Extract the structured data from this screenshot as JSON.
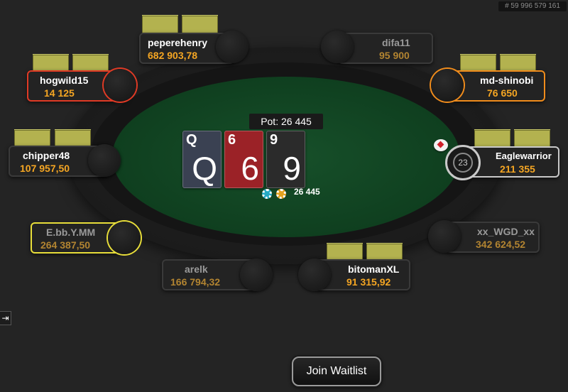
{
  "hand_id": "# 59 996 579 161",
  "pot": {
    "label": "Pot: 26 445"
  },
  "board": [
    {
      "rank": "Q",
      "suit": "spades",
      "color": "#3a4152"
    },
    {
      "rank": "6",
      "suit": "hearts",
      "color": "#9b2227"
    },
    {
      "rank": "9",
      "suit": "spades",
      "color": "#2b2b2b"
    }
  ],
  "bet": {
    "amount": "26 445"
  },
  "seats": [
    {
      "name": "peperehenry",
      "stack": "682 903,78",
      "status": "active"
    },
    {
      "name": "difa11",
      "stack": "95 900",
      "status": "folded"
    },
    {
      "name": "hogwild15",
      "stack": "14 125",
      "status": "highlighted",
      "highlight_color": "#e03a25"
    },
    {
      "name": "md-shinobi",
      "stack": "76 650",
      "status": "highlighted",
      "highlight_color": "#f08c1c"
    },
    {
      "name": "chipper48",
      "stack": "107 957,50",
      "status": "active"
    },
    {
      "name": "Eaglewarrior",
      "stack": "211 355",
      "status": "acting",
      "highlight_color": "#c9c9c9",
      "timer": "23"
    },
    {
      "name": "E.bb.Y.MM",
      "stack": "264 387,50",
      "status": "highlighted-folded",
      "highlight_color": "#e8de3a"
    },
    {
      "name": "xx_WGD_xx",
      "stack": "342 624,52",
      "status": "folded"
    },
    {
      "name": "arelk",
      "stack": "166 794,32",
      "status": "folded"
    },
    {
      "name": "bitomanXL",
      "stack": "91 315,92",
      "status": "active"
    }
  ],
  "icons": {
    "dealer": "dealer-button-icon",
    "chips": "chip-icon",
    "side_panel": "expand-panel-icon"
  },
  "side_button": {
    "label": "⇥"
  },
  "join_waitlist": {
    "label": "Join Waitlist"
  }
}
